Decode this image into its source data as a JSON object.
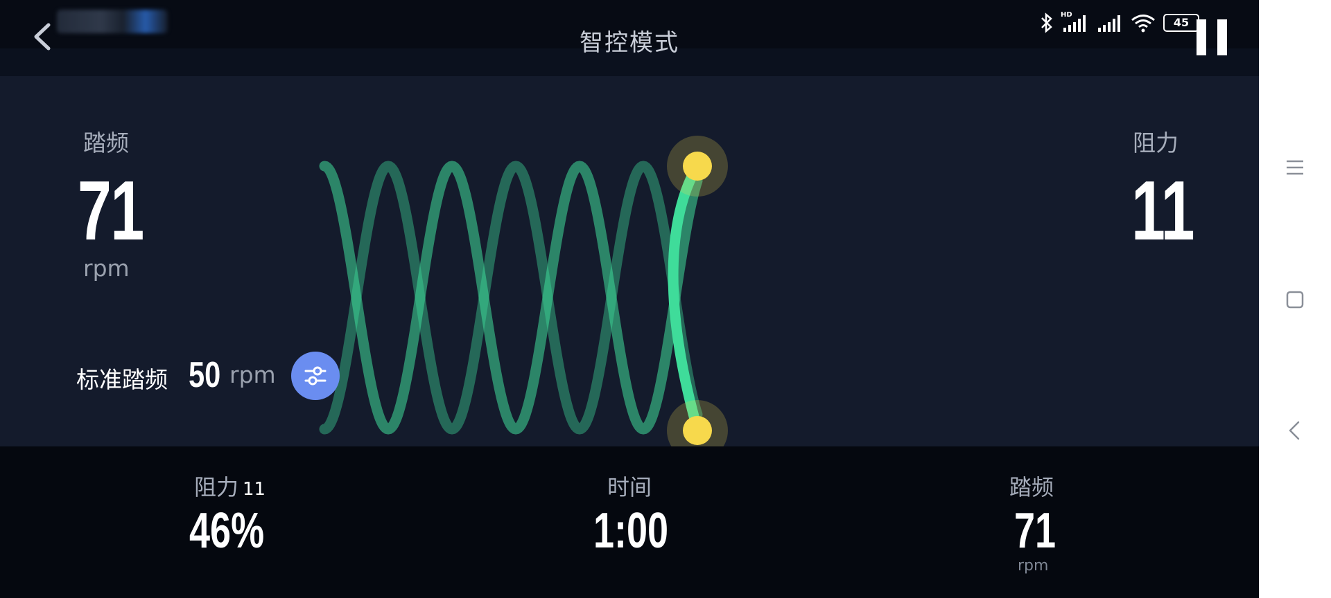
{
  "header": {
    "title": "智控模式"
  },
  "status_bar": {
    "hd": "HD",
    "battery": "45"
  },
  "metrics": {
    "cadence": {
      "label": "踏频",
      "value": "71",
      "unit": "rpm"
    },
    "resistance": {
      "label": "阻力",
      "value": "11"
    }
  },
  "standard": {
    "label": "标准踏频",
    "value": "50",
    "unit": "rpm"
  },
  "bottom": {
    "resistance": {
      "label": "阻力",
      "level": "11",
      "value": "46%"
    },
    "time": {
      "label": "时间",
      "value": "1:00"
    },
    "cadence": {
      "label": "踏频",
      "value": "71",
      "unit": "rpm"
    }
  },
  "colors": {
    "accent_green": "#3fdc9a",
    "marker_yellow": "#f7d94c",
    "button_blue": "#6a8df0"
  },
  "icons": {
    "back": "chevron-left-icon",
    "pause": "pause-icon",
    "settings": "sliders-icon",
    "nav_menu": "menu-icon",
    "nav_home": "square-icon",
    "nav_back": "triangle-back-icon"
  }
}
